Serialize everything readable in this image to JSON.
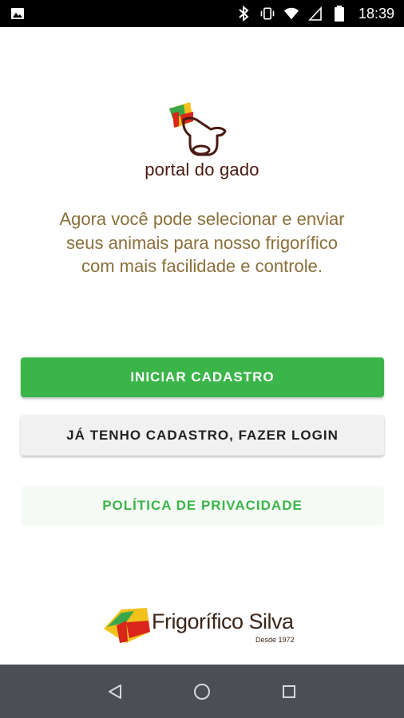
{
  "status_bar": {
    "time": "18:39",
    "icons": [
      "image-icon",
      "bluetooth-icon",
      "vibrate-icon",
      "wifi-icon",
      "signal-icon",
      "battery-icon"
    ]
  },
  "app": {
    "name": "portal do gado",
    "intro": "Agora você pode selecionar e enviar seus animais para nosso frigorífico com mais facilidade e controle."
  },
  "buttons": {
    "start_registration": "INICIAR CADASTRO",
    "login": "JÁ TENHO CADASTRO, FAZER LOGIN",
    "privacy_policy": "POLÍTICA DE PRIVACIDADE"
  },
  "company": {
    "name": "Frigorífico Silva",
    "tagline": "Desde 1972"
  },
  "nav_bar": {
    "icons": [
      "back-icon",
      "home-icon",
      "recents-icon"
    ]
  },
  "colors": {
    "primary": "#3bb54a",
    "brand_brown": "#4a1a12",
    "intro_text": "#8a6f3a",
    "nav_bar": "#4b4f55"
  }
}
